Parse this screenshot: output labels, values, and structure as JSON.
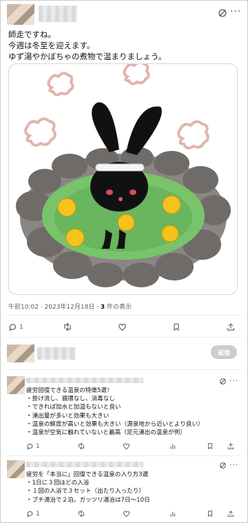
{
  "tweet": {
    "lines": [
      "師走ですね。",
      "今週は冬至を迎えます。",
      "ゆず湯やかぼちゃの煮物で温まりましょう。"
    ],
    "meta": {
      "time_date": "午前10:02 · 2023年12月18日 · ",
      "views_count": "3",
      "views_label": " 件の表示"
    },
    "actions": {
      "reply_count": "1"
    }
  },
  "reply_box": {
    "button_label": "返信"
  },
  "replies": [
    {
      "lines": [
        "疲労回復できる温泉の特徴5選！",
        "・掛け流し、循環なし、消毒なし",
        "・できれば加水と加温もないと良い",
        "・湧出量が多いと効果も大きい",
        "・温泉の鮮度が高いと効果も大きい（源泉地から近いとより良い）",
        "・温泉が空気に触れていないと最高（足元湧出の温泉が例）"
      ],
      "reply_count": "1"
    },
    {
      "lines": [
        "疲労を「本当に」回復できる温泉の入り方3選",
        "・1日に３回ほどの入浴",
        "・１回の入浴で３セット（出たり入ったり）",
        "・プチ湯治で２泊。ガッツリ湯治は7日〜10日"
      ],
      "reply_count": "1"
    }
  ],
  "colors": {
    "icon": "#536471",
    "divider": "#e6ecf0",
    "button_disabled": "#c8cdd0"
  }
}
